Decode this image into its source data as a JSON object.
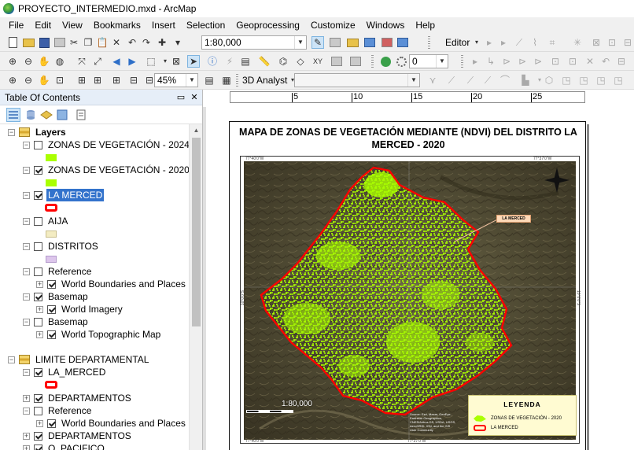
{
  "window": {
    "title": "PROYECTO_INTERMEDIO.mxd - ArcMap",
    "app_icon": "arcmap-globe-icon"
  },
  "menus": [
    "File",
    "Edit",
    "View",
    "Bookmarks",
    "Insert",
    "Selection",
    "Geoprocessing",
    "Customize",
    "Windows",
    "Help"
  ],
  "toolbar1": {
    "scale": "1:80,000",
    "editor_label": "Editor"
  },
  "toolbar2": {
    "layer_value": "0"
  },
  "toolbar3": {
    "zoom": "45%",
    "analyst_label": "3D Analyst",
    "analyst_value": ""
  },
  "toc": {
    "title": "Table Of Contents",
    "layers": [
      {
        "label": "Layers",
        "type": "group"
      },
      {
        "label": "ZONAS DE VEGETACIÓN - 2024",
        "checked": false
      },
      {
        "label": "ZONAS DE VEGETACIÓN - 2020",
        "checked": true
      },
      {
        "label": "LA MERCED",
        "checked": true,
        "selected": true
      },
      {
        "label": "AIJA",
        "checked": false
      },
      {
        "label": "DISTRITOS",
        "checked": false
      },
      {
        "label": "Reference",
        "checked": false
      },
      {
        "label": "World Boundaries and Places",
        "checked": true
      },
      {
        "label": "Basemap",
        "checked": true
      },
      {
        "label": "World Imagery",
        "checked": true
      },
      {
        "label": "Basemap",
        "checked": false
      },
      {
        "label": "World Topographic Map",
        "checked": true
      },
      {
        "label": "LIMITE DEPARTAMENTAL",
        "type": "group"
      },
      {
        "label": "LA_MERCED",
        "checked": true
      },
      {
        "label": "DEPARTAMENTOS",
        "checked": true
      },
      {
        "label": "Reference",
        "checked": false
      },
      {
        "label": "World Boundaries and Places",
        "checked": true
      },
      {
        "label": "DEPARTAMENTOS",
        "checked": true
      },
      {
        "label": "O_PACIFICO",
        "checked": true
      }
    ]
  },
  "colors": {
    "vegetation": "#aaff00",
    "boundary": "#ff0000",
    "aija": "#f3ecc2",
    "distritos": "#ddc6ec",
    "selection": "#3373cc"
  },
  "ruler": {
    "labels": [
      "5",
      "10",
      "15",
      "20",
      "25"
    ]
  },
  "map": {
    "title": "MAPA DE ZONAS DE VEGETACIÓN MEDIANTE (NDVI) DEL DISTRITO LA MERCED - 2020",
    "callout": "LA MERCED",
    "scale_text": "1:80,000",
    "credit": "Source: Esri, Maxar, GeoEye, Earthstar Geographics, CNES/Airbus DS, USDA, USGS, AeroGRID, IGN, and the GIS User Community",
    "coords": {
      "top_left": "77°40'0\"W",
      "top_right": "77°37'0\"W",
      "bottom_left": "77°40'0\"W",
      "bottom_right": "77°37'0\"W",
      "side_left": "10°0'0\"S",
      "side_right": "10°0'0\"S"
    },
    "legend": {
      "title": "LEYENDA",
      "items": [
        {
          "label": "ZONAS DE VEGETACIÓN - 2020",
          "color": "#aaff00"
        },
        {
          "label": "LA MERCED",
          "color": "#ff0000"
        }
      ]
    }
  }
}
